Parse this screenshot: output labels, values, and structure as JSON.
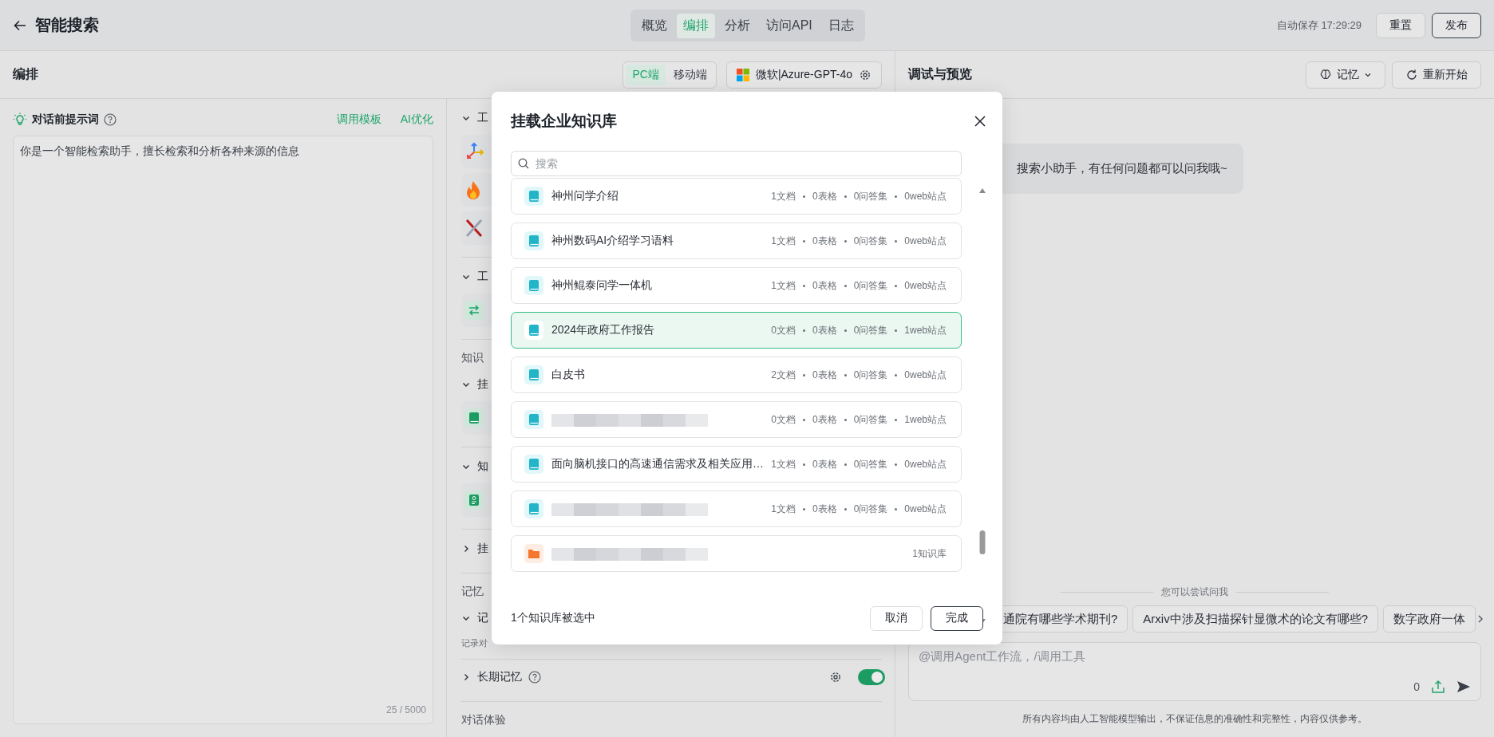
{
  "header": {
    "title": "智能搜索",
    "tabs": [
      {
        "label": "概览",
        "selected": false
      },
      {
        "label": "编排",
        "selected": true
      },
      {
        "label": "分析",
        "selected": false
      },
      {
        "label": "访问API",
        "selected": false
      },
      {
        "label": "日志",
        "selected": false
      }
    ],
    "autosave": "自动保存 17:29:29",
    "buttons": [
      {
        "label": "重置",
        "kind": "plain"
      },
      {
        "label": "发布",
        "kind": "outline"
      }
    ]
  },
  "editor": {
    "title": "编排",
    "device_toggle": [
      {
        "label": "PC端",
        "selected": true
      },
      {
        "label": "移动端",
        "selected": false
      }
    ],
    "model": "微软|Azure-GPT-4o"
  },
  "prompt": {
    "title": "对话前提示词",
    "actions": [
      "调用模板",
      "AI优化"
    ],
    "value": "你是一个智能检索助手，擅长检索和分析各种来源的信息",
    "counter": "25 / 5000"
  },
  "config": {
    "items": [
      {
        "kind": "group",
        "label": "工",
        "expanded": true
      },
      {
        "kind": "card"
      },
      {
        "kind": "card"
      },
      {
        "kind": "card"
      },
      {
        "kind": "divider"
      },
      {
        "kind": "group",
        "label": "工",
        "expanded": true
      },
      {
        "kind": "card"
      },
      {
        "kind": "divider"
      },
      {
        "kind": "section",
        "label": "知识"
      },
      {
        "kind": "group",
        "label": "挂",
        "expanded": true
      },
      {
        "kind": "card"
      },
      {
        "kind": "divider"
      },
      {
        "kind": "group",
        "label": "知",
        "expanded": true
      },
      {
        "kind": "card"
      },
      {
        "kind": "divider"
      },
      {
        "kind": "group",
        "label": "挂",
        "expanded": false
      },
      {
        "kind": "divider"
      },
      {
        "kind": "section",
        "label": "记忆"
      },
      {
        "kind": "group",
        "label": "记",
        "expanded": true
      },
      {
        "kind": "note",
        "label": "记录对"
      },
      {
        "kind": "divider"
      },
      {
        "kind": "switch",
        "label": "长期记忆",
        "expanded": false,
        "on": true
      },
      {
        "kind": "divider"
      },
      {
        "kind": "section",
        "label": "对话体验"
      }
    ]
  },
  "preview": {
    "title": "调试与预览",
    "buttons": [
      {
        "label": "记忆",
        "kind": "dropdown"
      },
      {
        "label": "重新开始",
        "kind": "restart"
      }
    ],
    "message": "搜索小助手，有任何问题都可以问我哦~",
    "suggestions_title": "您可以尝试问我",
    "suggestions": [
      "通院有哪些学术期刊?",
      "Arxiv中涉及扫描探针显微术的论文有哪些?",
      "数字政府一体"
    ],
    "input": {
      "placeholder": "@调用Agent工作流，/调用工具",
      "count": "0"
    },
    "disclaimer": "所有内容均由人工智能模型输出，不保证信息的准确性和完整性，内容仅供参考。"
  },
  "dialog": {
    "title": "挂载企业知识库",
    "search": {
      "placeholder": "搜索"
    },
    "items": [
      {
        "kind": "kb",
        "name": "神州问学介绍",
        "stats": [
          "1文档",
          "0表格",
          "0问答集",
          "0web站点"
        ],
        "selected": false
      },
      {
        "kind": "kb",
        "name": "神州数码AI介绍学习语料",
        "stats": [
          "1文档",
          "0表格",
          "0问答集",
          "0web站点"
        ],
        "selected": false
      },
      {
        "kind": "kb",
        "name": "神州鲲泰问学一体机",
        "stats": [
          "1文档",
          "0表格",
          "0问答集",
          "0web站点"
        ],
        "selected": false
      },
      {
        "kind": "kb",
        "name": "2024年政府工作报告",
        "stats": [
          "0文档",
          "0表格",
          "0问答集",
          "1web站点"
        ],
        "selected": true
      },
      {
        "kind": "kb",
        "name": "白皮书",
        "stats": [
          "2文档",
          "0表格",
          "0问答集",
          "0web站点"
        ],
        "selected": false
      },
      {
        "kind": "kb",
        "stats": [
          "0文档",
          "0表格",
          "0问答集",
          "1web站点"
        ],
        "selected": false
      },
      {
        "kind": "kb",
        "name": "面向脑机接口的高速通信需求及相关应用…",
        "stats": [
          "1文档",
          "0表格",
          "0问答集",
          "0web站点"
        ],
        "selected": false
      },
      {
        "kind": "kb",
        "stats": [
          "1文档",
          "0表格",
          "0问答集",
          "0web站点"
        ],
        "selected": false
      },
      {
        "kind": "folder",
        "count": "1知识库",
        "selected": false
      }
    ],
    "footer": "1个知识库被选中",
    "buttons": [
      {
        "label": "取消",
        "kind": "plain"
      },
      {
        "label": "完成",
        "kind": "primary"
      }
    ]
  }
}
